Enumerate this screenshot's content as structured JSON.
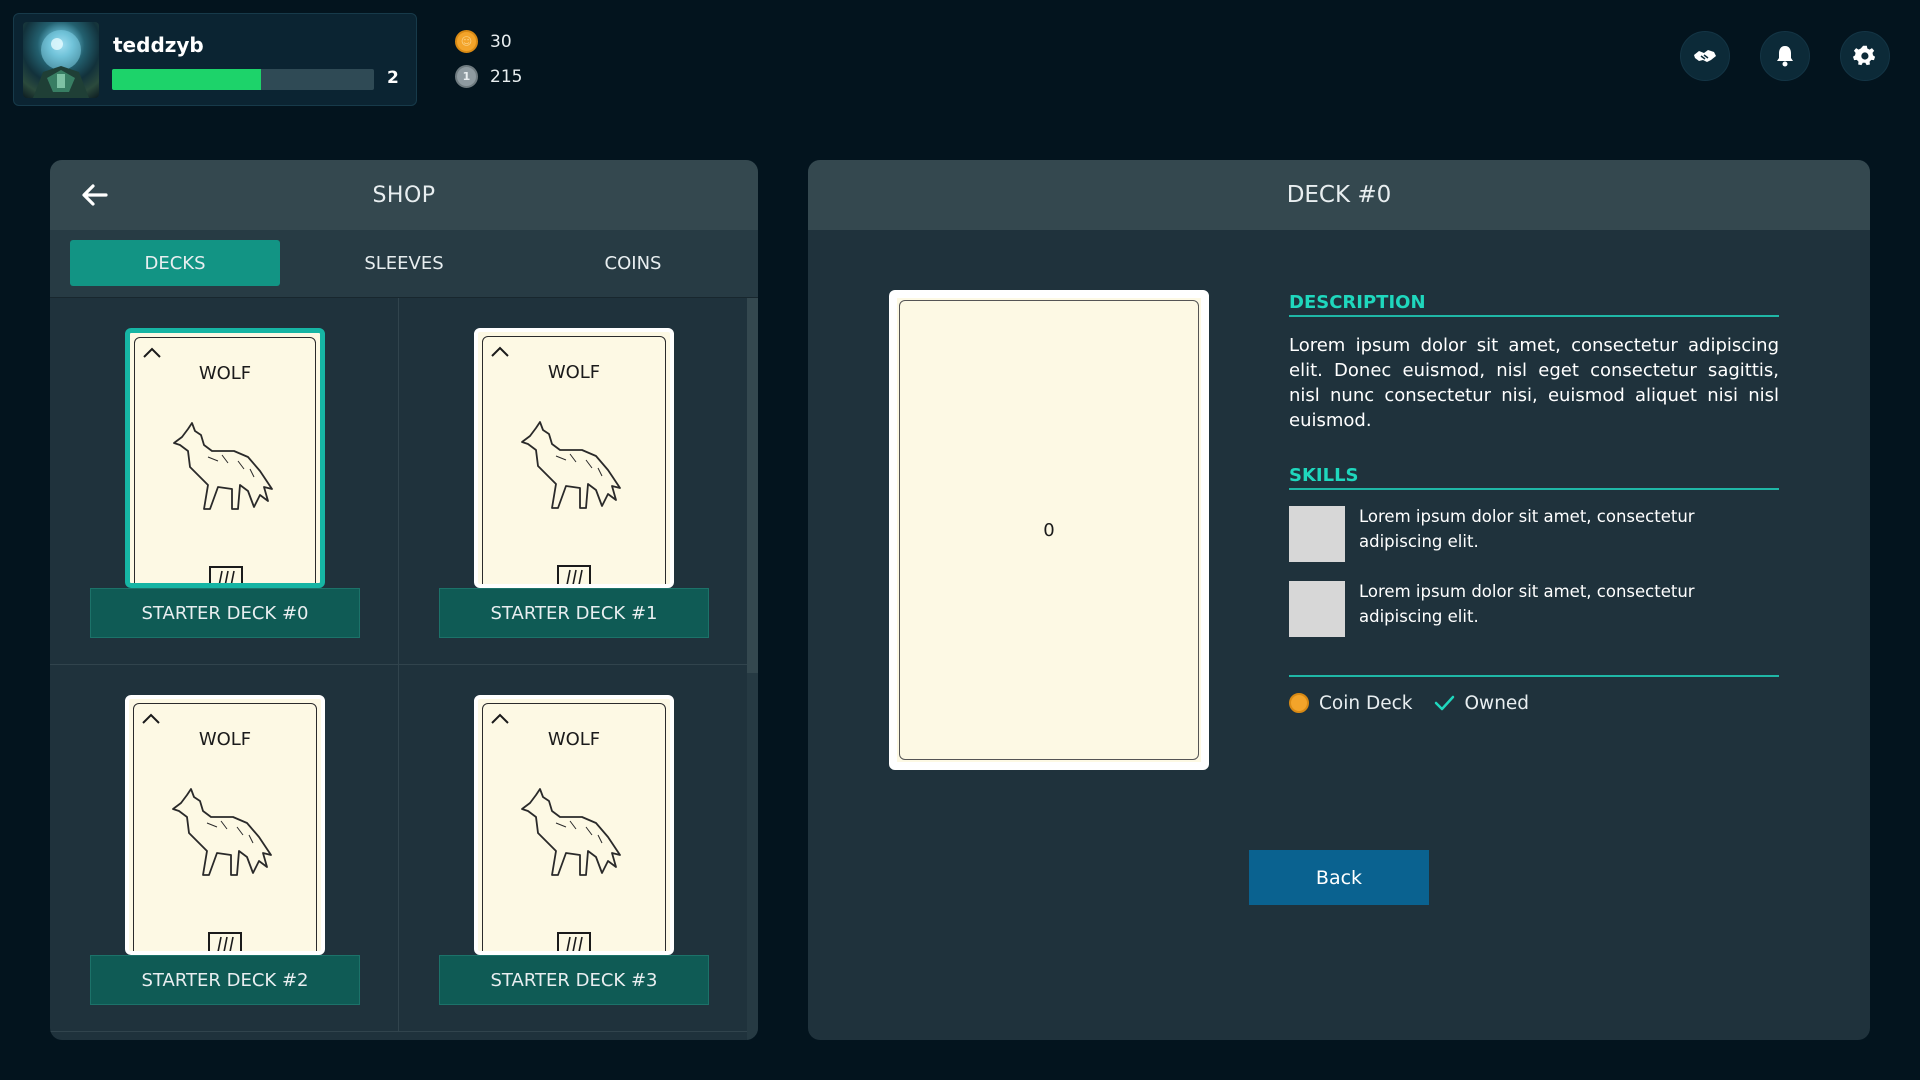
{
  "player": {
    "username": "teddzyb",
    "level": "2",
    "xp_progress": 0.57,
    "avatar_icon": "avatar-image"
  },
  "currencies": {
    "gold": {
      "amount": "30",
      "icon": "gold-coin-icon"
    },
    "silver": {
      "amount": "215",
      "icon": "silver-coin-icon",
      "glyph": "1"
    }
  },
  "top_actions": [
    {
      "name": "trade-button",
      "icon": "handshake-icon"
    },
    {
      "name": "notifications-button",
      "icon": "bell-icon"
    },
    {
      "name": "settings-button",
      "icon": "gear-icon"
    }
  ],
  "shop": {
    "title": "SHOP",
    "tabs": [
      "DECKS",
      "SLEEVES",
      "COINS"
    ],
    "active_tab": "DECKS",
    "decks": [
      {
        "card_title": "WOLF",
        "label": "STARTER DECK #0",
        "selected": true
      },
      {
        "card_title": "WOLF",
        "label": "STARTER DECK #1",
        "selected": false
      },
      {
        "card_title": "WOLF",
        "label": "STARTER DECK #2",
        "selected": false
      },
      {
        "card_title": "WOLF",
        "label": "STARTER DECK #3",
        "selected": false
      }
    ]
  },
  "detail": {
    "title": "DECK #0",
    "card_number": "0",
    "description_title": "DESCRIPTION",
    "description": "Lorem ipsum dolor sit amet, consectetur adipiscing elit. Donec euismod, nisl eget consectetur sagittis, nisl nunc consectetur nisi, euismod aliquet nisi nisl euismod.",
    "skills_title": "SKILLS",
    "skills": [
      {
        "text": "Lorem ipsum dolor sit amet, consectetur adipiscing elit."
      },
      {
        "text": "Lorem ipsum dolor sit amet, consectetur adipiscing elit."
      }
    ],
    "tags": {
      "coin_deck": "Coin Deck",
      "owned": "Owned"
    },
    "back_label": "Back"
  },
  "colors": {
    "background": "#03141e",
    "panel": "#1f323c",
    "panel_header": "#34484f",
    "accent_teal": "#16b5a4",
    "xp_green": "#1dd36a",
    "gold": "#f3a42a",
    "button_blue": "#0a6290"
  }
}
